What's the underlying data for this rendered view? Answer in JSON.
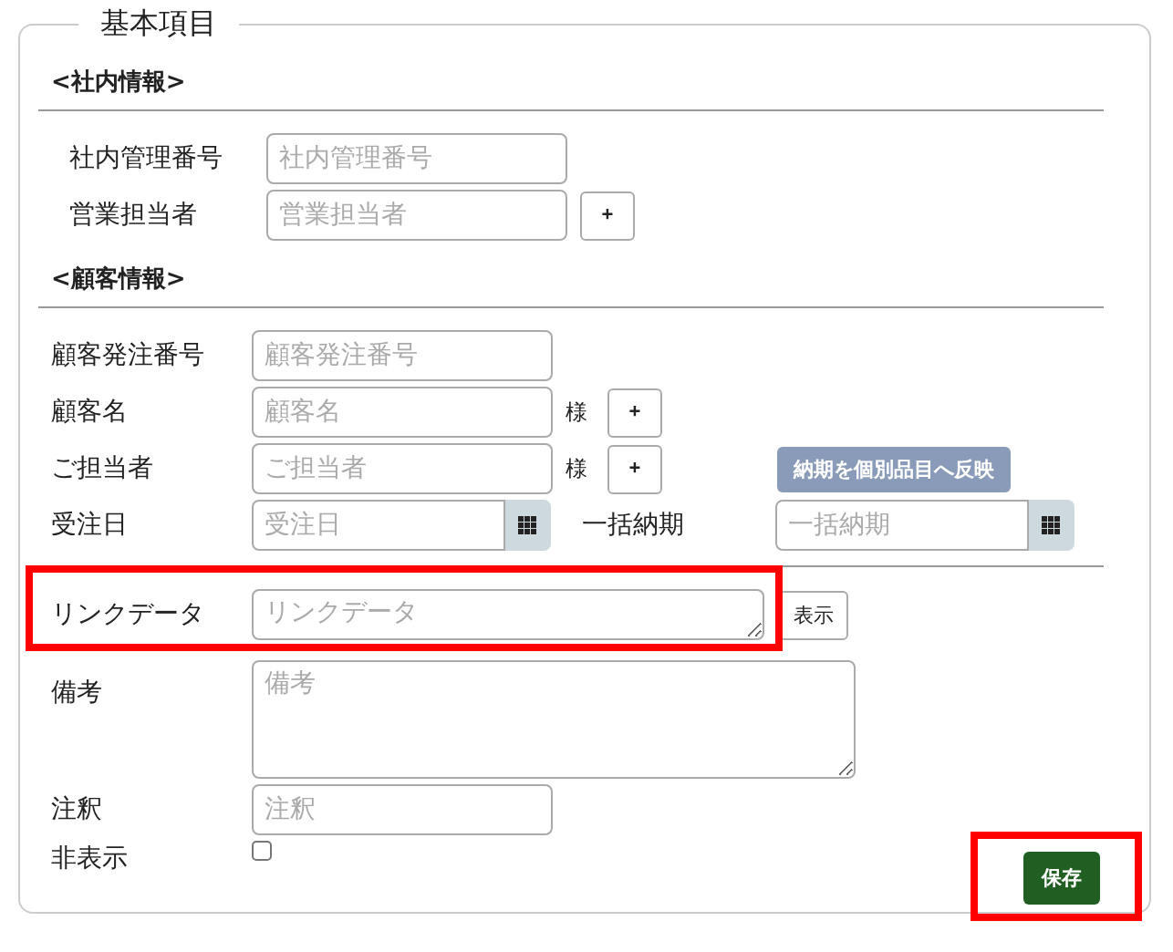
{
  "panel": {
    "legend": "基本項目"
  },
  "sections": [
    {
      "heading": "<社内情報>",
      "rows": [
        {
          "kind": "text",
          "label": "社内管理番号",
          "placeholder": "社内管理番号"
        },
        {
          "kind": "text",
          "label": "営業担当者",
          "placeholder": "営業担当者",
          "add": "+"
        }
      ]
    },
    {
      "heading": "<顧客情報>",
      "rows": [
        {
          "kind": "text",
          "label": "顧客発注番号",
          "placeholder": "顧客発注番号"
        },
        {
          "kind": "text",
          "label": "顧客名",
          "placeholder": "顧客名",
          "suffix": "様",
          "add": "+"
        },
        {
          "kind": "text",
          "label": "ご担当者",
          "placeholder": "ご担当者",
          "suffix": "様",
          "add": "+",
          "action": {
            "label": "納期を個別品目へ反映",
            "disabled": true
          }
        },
        {
          "kind": "date",
          "label": "受注日",
          "placeholder": "受注日",
          "second": {
            "label": "一括納期",
            "placeholder": "一括納期"
          }
        }
      ]
    },
    {
      "rows": [
        {
          "kind": "link",
          "label": "リンクデータ",
          "placeholder": "リンクデータ",
          "button": "表示",
          "highlighted": true
        },
        {
          "kind": "textarea",
          "label": "備考",
          "placeholder": "備考"
        },
        {
          "kind": "text",
          "label": "注釈",
          "placeholder": "注釈"
        },
        {
          "kind": "checkbox",
          "label": "非表示",
          "checked": false
        }
      ]
    }
  ],
  "save": {
    "label": "保存",
    "highlighted": true
  }
}
